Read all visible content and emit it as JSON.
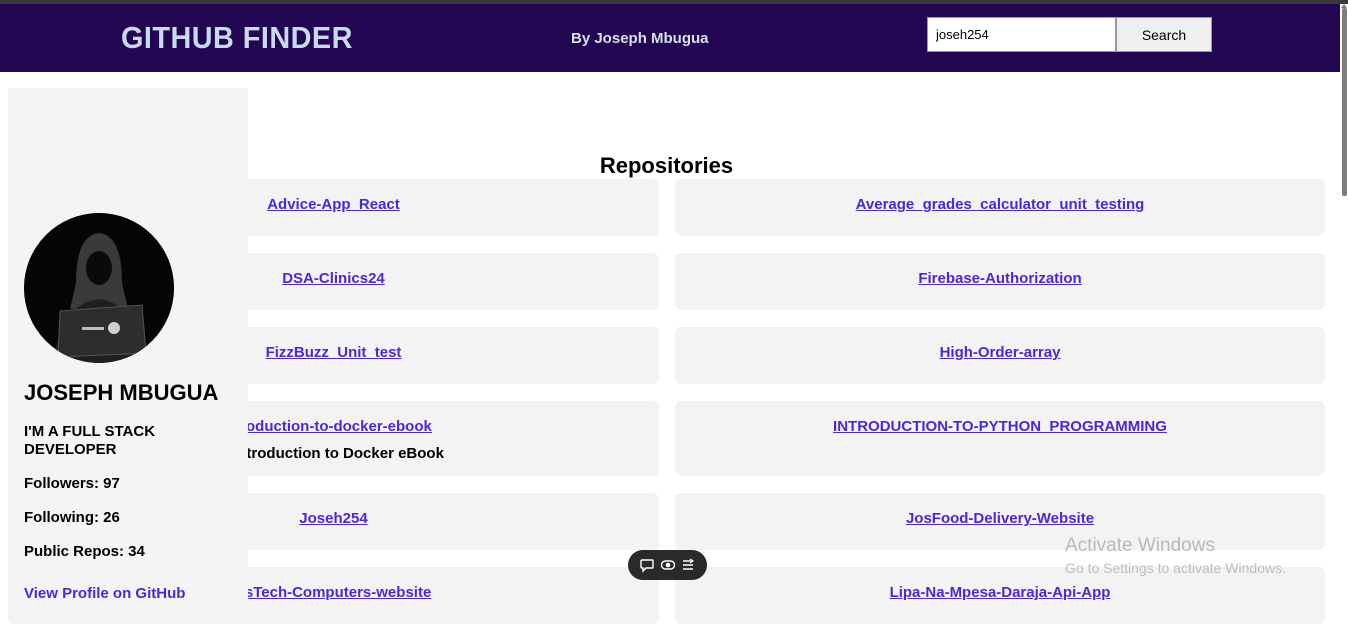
{
  "header": {
    "brand": "GITHUB FINDER",
    "byline": "By Joseph Mbugua",
    "search_value": "joseh254",
    "search_button": "Search"
  },
  "profile": {
    "name": "JOSEPH MBUGUA",
    "bio": "I'M A FULL STACK DEVELOPER",
    "followers": "Followers: 97",
    "following": "Following: 26",
    "public_repos": "Public Repos: 34",
    "profile_link": "View Profile on GitHub"
  },
  "repos_title": "Repositories",
  "repos_left": [
    {
      "name": "Advice-App_React"
    },
    {
      "name": "DSA-Clinics24"
    },
    {
      "name": "FizzBuzz_Unit_test"
    },
    {
      "name": "troduction-to-docker-ebook",
      "description": "Introduction to Docker eBook"
    },
    {
      "name": "Joseh254"
    },
    {
      "name": "osTech-Computers-website"
    }
  ],
  "repos_right": [
    {
      "name": "Average_grades_calculator_unit_testing"
    },
    {
      "name": "Firebase-Authorization"
    },
    {
      "name": "High-Order-array"
    },
    {
      "name": "INTRODUCTION-TO-PYTHON_PROGRAMMING"
    },
    {
      "name": "JosFood-Delivery-Website"
    },
    {
      "name": "Lipa-Na-Mpesa-Daraja-Api-App"
    }
  ],
  "overlay": {
    "activate_title": "Activate Windows",
    "activate_sub": "Go to Settings to activate Windows."
  },
  "icons": {
    "pill": [
      "chat-bubble-icon",
      "toggle-icon",
      "menu-lines-icon"
    ]
  },
  "colors": {
    "header_bg": "#230652",
    "link": "#4d27d6",
    "card_bg": "#f3f3f3"
  }
}
